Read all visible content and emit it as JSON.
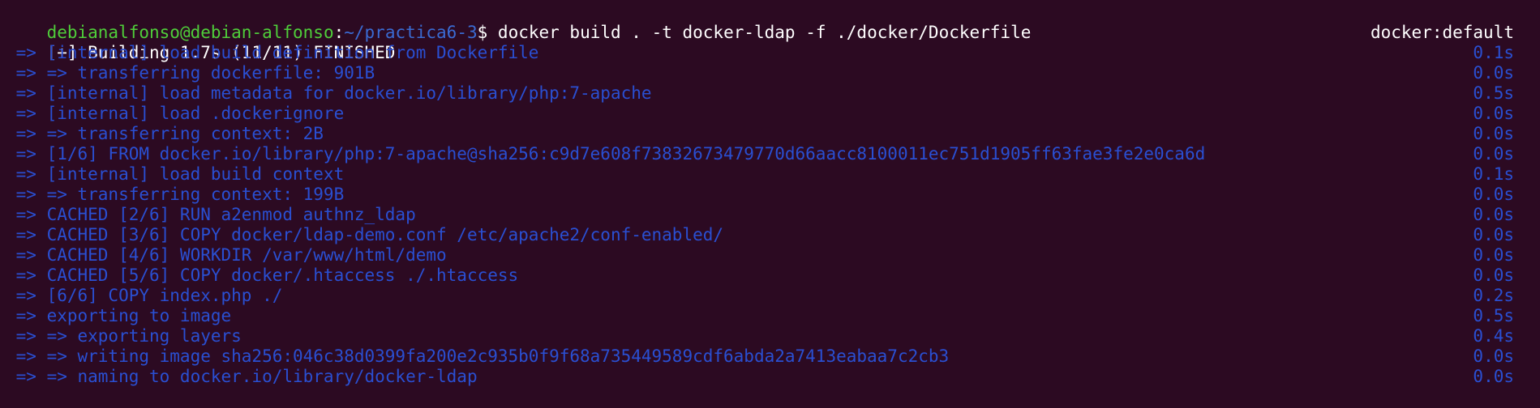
{
  "prompt": {
    "user_host": "debianalfonso@debian-alfonso",
    "colon": ":",
    "path": "~/practica6-3",
    "dollar": "$"
  },
  "command": " docker build . -t docker-ldap -f ./docker/Dockerfile",
  "header": {
    "status": "[+] Building 1.7s (11/11) FINISHED",
    "context": "docker:default"
  },
  "steps": [
    {
      "text": " => [internal] load build definition from Dockerfile",
      "time": "0.1s"
    },
    {
      "text": " => => transferring dockerfile: 901B",
      "time": "0.0s"
    },
    {
      "text": " => [internal] load metadata for docker.io/library/php:7-apache",
      "time": "0.5s"
    },
    {
      "text": " => [internal] load .dockerignore",
      "time": "0.0s"
    },
    {
      "text": " => => transferring context: 2B",
      "time": "0.0s"
    },
    {
      "text": " => [1/6] FROM docker.io/library/php:7-apache@sha256:c9d7e608f73832673479770d66aacc8100011ec751d1905ff63fae3fe2e0ca6d",
      "time": "0.0s"
    },
    {
      "text": " => [internal] load build context",
      "time": "0.1s"
    },
    {
      "text": " => => transferring context: 199B",
      "time": "0.0s"
    },
    {
      "text": " => CACHED [2/6] RUN a2enmod authnz_ldap",
      "time": "0.0s"
    },
    {
      "text": " => CACHED [3/6] COPY docker/ldap-demo.conf /etc/apache2/conf-enabled/",
      "time": "0.0s"
    },
    {
      "text": " => CACHED [4/6] WORKDIR /var/www/html/demo",
      "time": "0.0s"
    },
    {
      "text": " => CACHED [5/6] COPY docker/.htaccess ./.htaccess",
      "time": "0.0s"
    },
    {
      "text": " => [6/6] COPY index.php ./",
      "time": "0.2s"
    },
    {
      "text": " => exporting to image",
      "time": "0.5s"
    },
    {
      "text": " => => exporting layers",
      "time": "0.4s"
    },
    {
      "text": " => => writing image sha256:046c38d0399fa200e2c935b0f9f68a735449589cdf6abda2a7413eabaa7c2cb3",
      "time": "0.0s"
    },
    {
      "text": " => => naming to docker.io/library/docker-ldap",
      "time": "0.0s"
    }
  ],
  "colors": {
    "background": "#2c0a22",
    "prompt_user": "#4fce3a",
    "prompt_path": "#3a6bd3",
    "build_output": "#2a4fd2",
    "cursor": "#c8f4dc"
  }
}
